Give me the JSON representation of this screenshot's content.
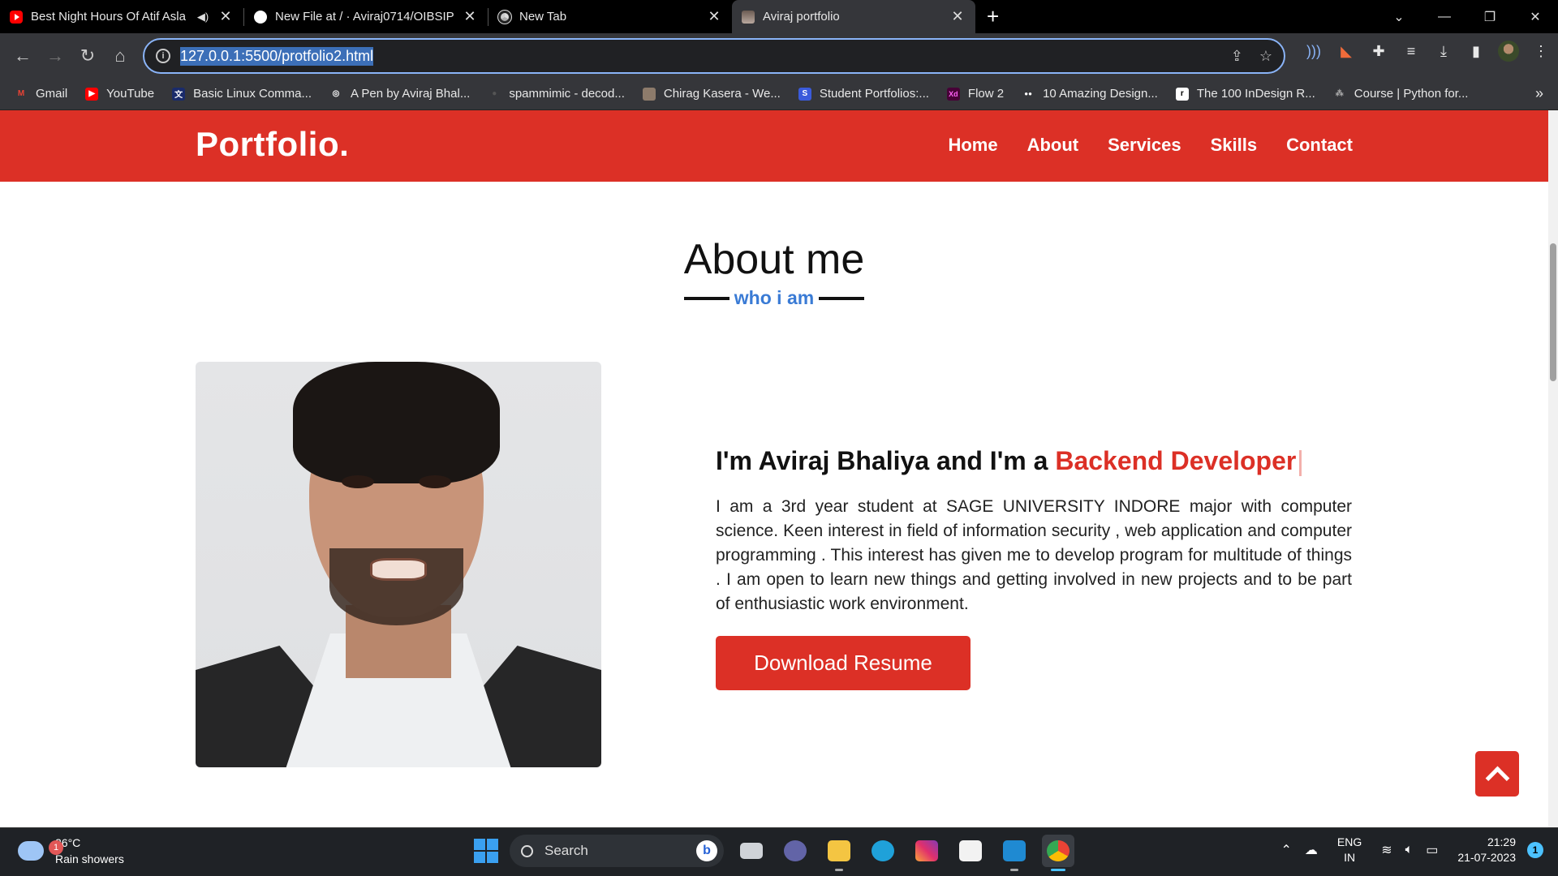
{
  "browser": {
    "tabs": [
      {
        "title": "Best Night Hours Of Atif Asla",
        "icon": "youtube-icon",
        "audio": true
      },
      {
        "title": "New File at / · Aviraj0714/OIBSIP",
        "icon": "github-icon"
      },
      {
        "title": "New Tab",
        "icon": "chrome-icon"
      },
      {
        "title": "Aviraj portfolio",
        "icon": "site-photo-icon",
        "active": true
      }
    ],
    "url": "127.0.0.1:5500/protfolio2.html",
    "bookmarks": [
      {
        "label": "Gmail",
        "color": "#ea4335",
        "glyph": "M"
      },
      {
        "label": "YouTube",
        "color": "#ff0000",
        "glyph": "▶"
      },
      {
        "label": "Basic Linux Comma...",
        "color": "#1a2b6b",
        "glyph": "文"
      },
      {
        "label": "A Pen by Aviraj Bhal...",
        "color": "#444",
        "glyph": "◎"
      },
      {
        "label": "spammimic - decod...",
        "color": "#222",
        "glyph": "●"
      },
      {
        "label": "Chirag Kasera - We...",
        "color": "#8d7b6b",
        "glyph": ""
      },
      {
        "label": "Student Portfolios:...",
        "color": "#3b5bdb",
        "glyph": "S"
      },
      {
        "label": "Flow 2",
        "color": "#470137",
        "glyph": "Xd"
      },
      {
        "label": "10 Amazing Design...",
        "color": "#000",
        "glyph": "●●"
      },
      {
        "label": "The 100 InDesign R...",
        "color": "#ffffff",
        "glyph": "r"
      },
      {
        "label": "Course | Python for...",
        "color": "#444",
        "glyph": "⁂"
      }
    ]
  },
  "site": {
    "logo": "Portfolio.",
    "nav": [
      "Home",
      "About",
      "Services",
      "Skills",
      "Contact"
    ],
    "section_title": "About me",
    "section_subtitle": "who i am",
    "intro_prefix": "I'm Aviraj Bhaliya and I'm a ",
    "intro_role": "Backend Developer",
    "bio": "I am a 3rd year student at SAGE UNIVERSITY INDORE major with computer science. Keen interest in field of information security , web application and computer programming . This interest has given me to develop program for multitude of things . I am open to learn new things and getting involved in new projects and to be part of enthusiastic work environment.",
    "button": "Download Resume",
    "accent": "#dc3026",
    "subtitle_color": "#3a7bd5"
  },
  "taskbar": {
    "weather_temp": "26°C",
    "weather_desc": "Rain showers",
    "weather_badge": "1",
    "search_label": "Search",
    "lang_1": "ENG",
    "lang_2": "IN",
    "time": "21:29",
    "date": "21-07-2023",
    "notifications": "1"
  }
}
